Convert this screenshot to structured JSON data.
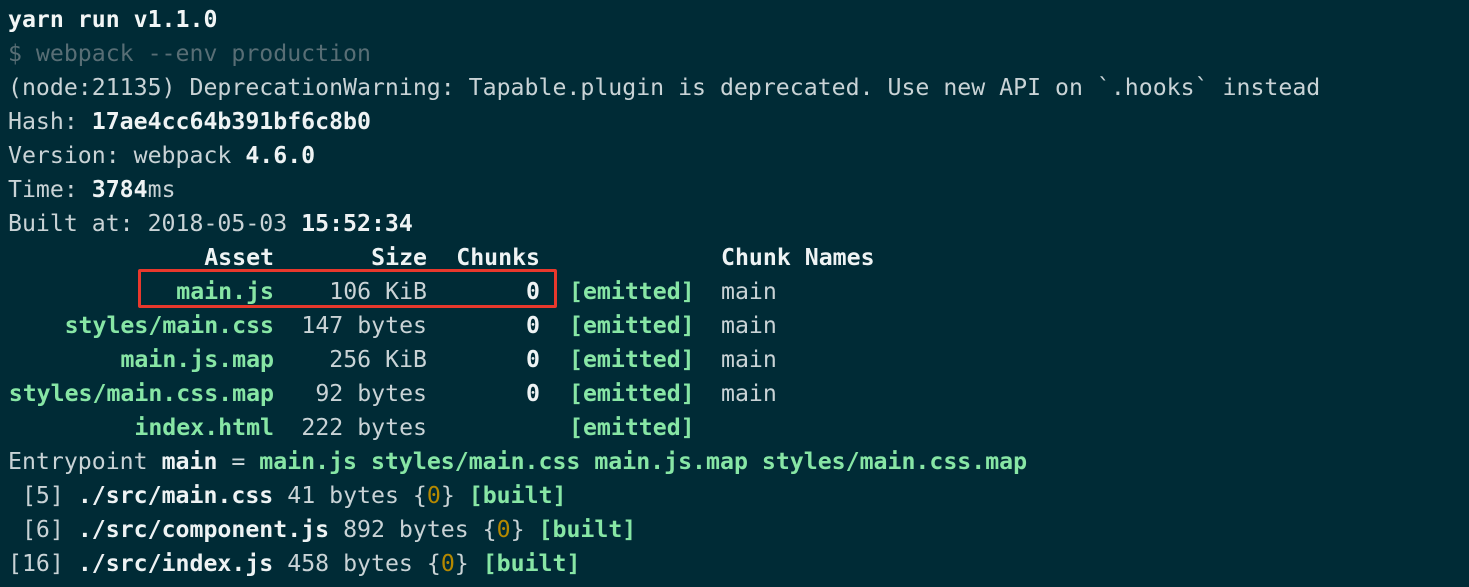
{
  "header": {
    "command_title": "yarn run v1.1.0",
    "shell_command": "$ webpack --env production",
    "warning": "(node:21135) DeprecationWarning: Tapable.plugin is deprecated. Use new API on `.hooks` instead"
  },
  "build_info": {
    "hash_label": "Hash: ",
    "hash_value": "17ae4cc64b391bf6c8b0",
    "version_label": "Version: webpack ",
    "version_value": "4.6.0",
    "time_label": "Time: ",
    "time_value": "3784",
    "time_unit": "ms",
    "built_label": "Built at: 2018-05-03 ",
    "built_time": "15:52:34"
  },
  "assets_table": {
    "headers": {
      "asset": "Asset",
      "size": "Size",
      "chunks": "Chunks",
      "chunk_names": "Chunk Names"
    },
    "rows": [
      {
        "asset": "main.js",
        "size": "106 KiB",
        "chunks": "0",
        "status": "[emitted]",
        "chunk_name": "main"
      },
      {
        "asset": "styles/main.css",
        "size": "147 bytes",
        "chunks": "0",
        "status": "[emitted]",
        "chunk_name": "main"
      },
      {
        "asset": "main.js.map",
        "size": "256 KiB",
        "chunks": "0",
        "status": "[emitted]",
        "chunk_name": "main"
      },
      {
        "asset": "styles/main.css.map",
        "size": "92 bytes",
        "chunks": "0",
        "status": "[emitted]",
        "chunk_name": "main"
      },
      {
        "asset": "index.html",
        "size": "222 bytes",
        "chunks": "",
        "status": "[emitted]",
        "chunk_name": ""
      }
    ]
  },
  "entrypoint": {
    "label": "Entrypoint ",
    "name": "main",
    "equals": " = ",
    "files": "main.js styles/main.css main.js.map styles/main.css.map"
  },
  "modules": [
    {
      "id": " [5]",
      "path": "./src/main.css",
      "size": "41 bytes",
      "brace_open": "{",
      "chunk": "0",
      "brace_close": "}",
      "status": "[built]"
    },
    {
      "id": " [6]",
      "path": "./src/component.js",
      "size": "892 bytes",
      "brace_open": "{",
      "chunk": "0",
      "brace_close": "}",
      "status": "[built]"
    },
    {
      "id": "[16]",
      "path": "./src/index.js",
      "size": "458 bytes",
      "brace_open": "{",
      "chunk": "0",
      "brace_close": "}",
      "status": "[built]"
    }
  ],
  "colors": {
    "background": "#002b36",
    "green": "#87e6a5",
    "highlight": "#e8382c",
    "chunk_number": "#b58900"
  }
}
